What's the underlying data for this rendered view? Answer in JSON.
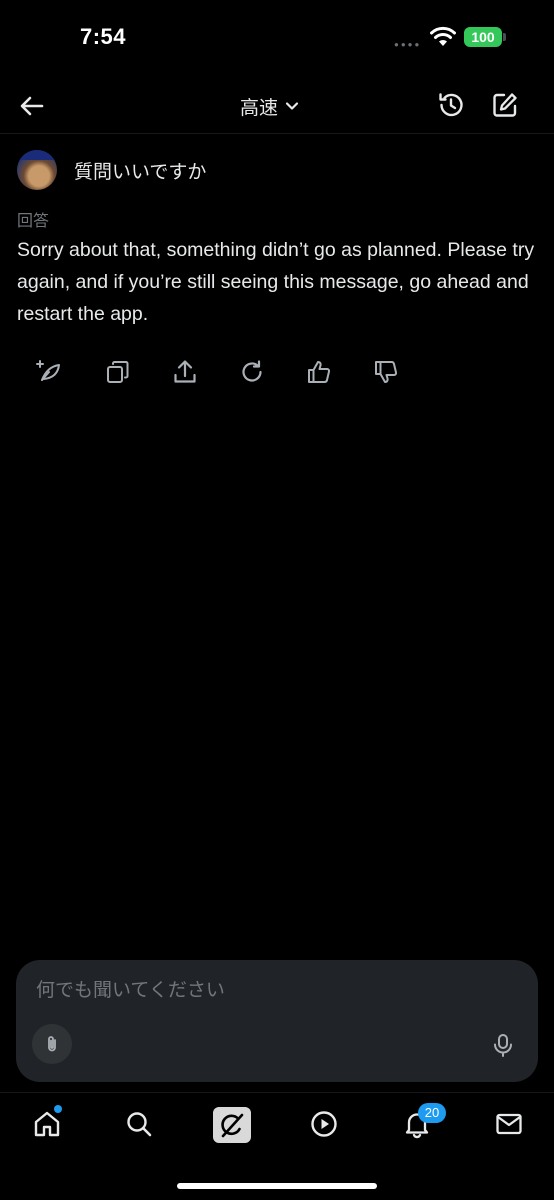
{
  "status_bar": {
    "time": "7:54",
    "battery": "100"
  },
  "header": {
    "mode": "高速"
  },
  "conversation": {
    "question": "質問いいですか",
    "answer_label": "回答",
    "answer_text": "Sorry about that, something didn’t go as planned. Please try again, and if you’re still seeing this message, go ahead and restart the app."
  },
  "composer": {
    "placeholder": "何でも聞いてください"
  },
  "nav": {
    "notifications_count": "20"
  },
  "colors": {
    "accent": "#1d9bf0",
    "battery": "#34c759",
    "background": "#000000",
    "composer": "#202327"
  }
}
